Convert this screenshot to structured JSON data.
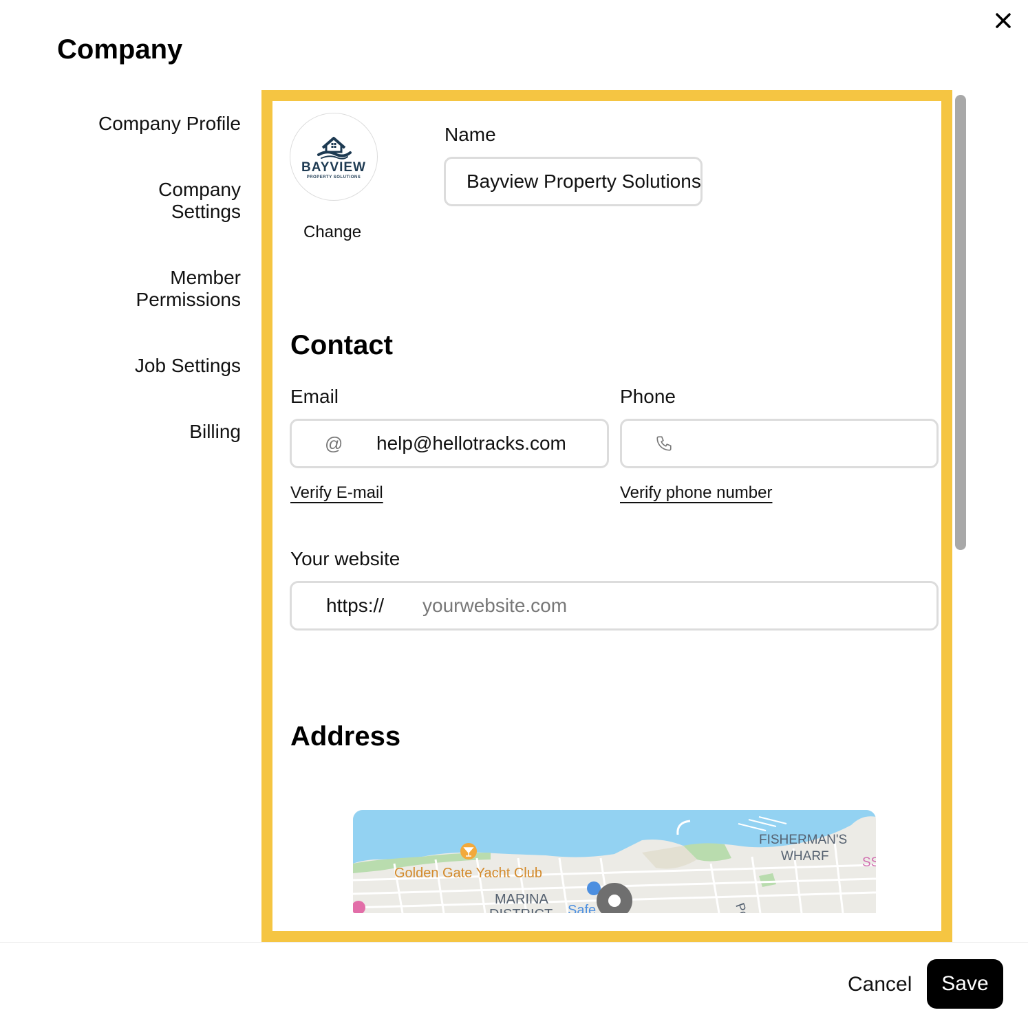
{
  "header": {
    "title": "Company",
    "close_icon": "close-icon"
  },
  "sidebar": {
    "items": [
      {
        "label_lines": [
          "Company Profile"
        ]
      },
      {
        "label_lines": [
          "Company",
          "Settings"
        ]
      },
      {
        "label_lines": [
          "Member",
          "Permissions"
        ]
      },
      {
        "label_lines": [
          "Job Settings"
        ]
      },
      {
        "label_lines": [
          "Billing"
        ]
      }
    ]
  },
  "profile": {
    "logo": {
      "word": "BAYVIEW",
      "subtitle": "PROPERTY SOLUTIONS"
    },
    "change_label": "Change",
    "name_label": "Name",
    "name_value": "Bayview Property Solutions"
  },
  "contact": {
    "title": "Contact",
    "email_label": "Email",
    "email_prefix": "@",
    "email_value": "help@hellotracks.com",
    "verify_email": "Verify E-mail",
    "phone_label": "Phone",
    "phone_icon": "phone-icon",
    "phone_value": "",
    "verify_phone": "Verify phone number",
    "website_label": "Your website",
    "website_prefix": "https://",
    "website_placeholder": "yourwebsite.com",
    "website_value": ""
  },
  "address": {
    "title": "Address",
    "map_labels": {
      "yacht_club": "Golden Gate Yacht Club",
      "marina": "MARINA",
      "district": "DISTRICT",
      "fishermans": "FISHERMAN'S",
      "wharf": "WHARF",
      "safeway": "Safe",
      "ss": "SS",
      "po": "Po"
    }
  },
  "footer": {
    "cancel_label": "Cancel",
    "save_label": "Save"
  },
  "colors": {
    "panel_border": "#f5c542",
    "map_water": "#93d2f2",
    "map_land": "#ecebe6"
  }
}
